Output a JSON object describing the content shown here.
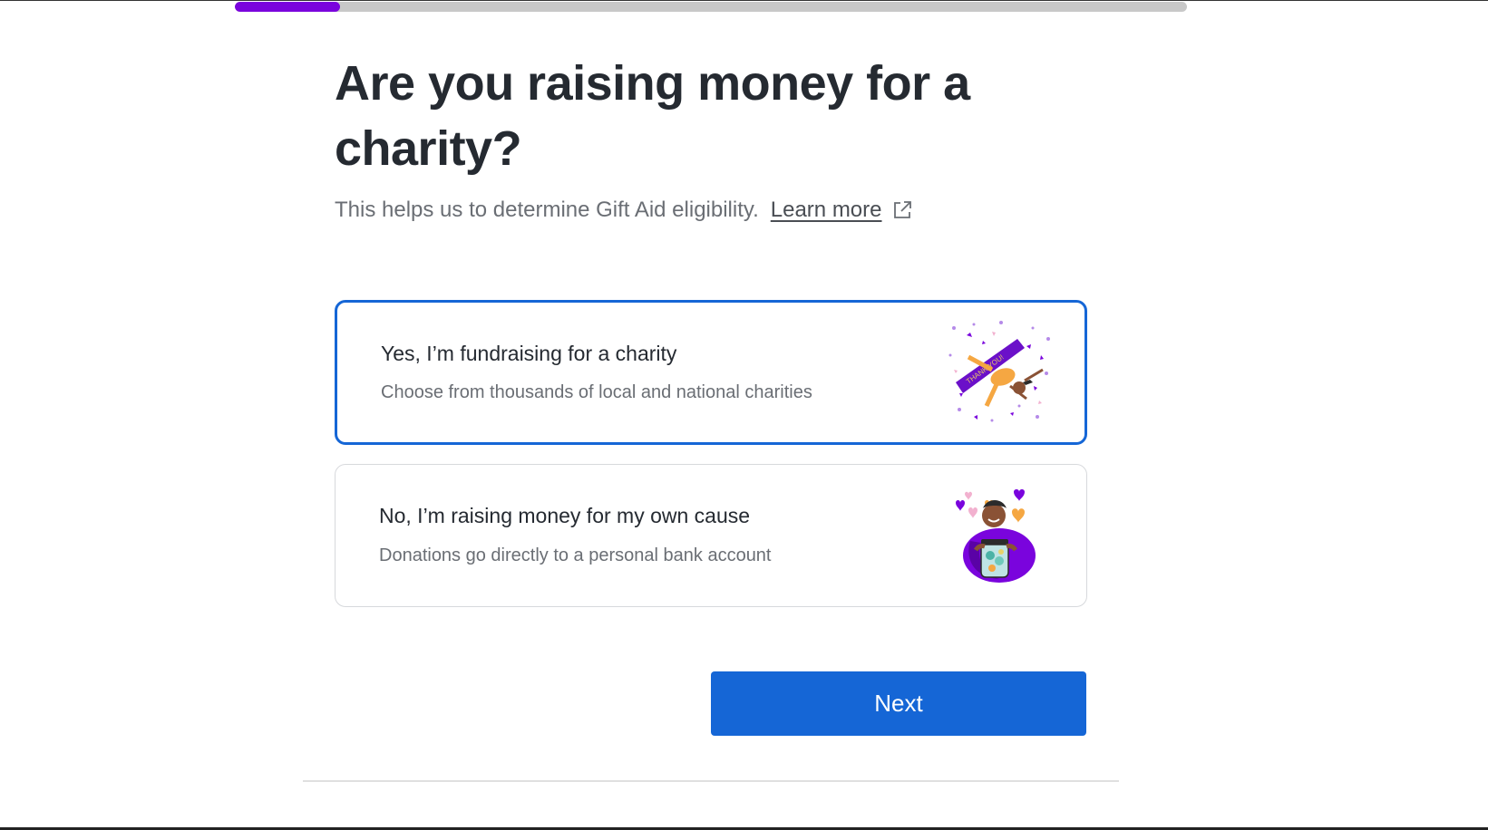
{
  "progress": {
    "value_percent": 11
  },
  "header": {
    "title": "Are you raising money for a charity?",
    "subtitle": "This helps us to determine Gift Aid eligibility.",
    "learn_more": "Learn more"
  },
  "options": [
    {
      "title": "Yes, I’m fundraising for a charity",
      "description": "Choose from thousands of local and national charities",
      "illustration_text": "THANK YOU!",
      "selected": true
    },
    {
      "title": "No, I’m raising money for my own cause",
      "description": "Donations go directly to a personal bank account",
      "selected": false
    }
  ],
  "actions": {
    "next_label": "Next"
  },
  "colors": {
    "accent": "#1566d6",
    "progress": "#7a04dd",
    "illustration_purple": "#7a04dd",
    "illustration_orange": "#f5a742"
  }
}
